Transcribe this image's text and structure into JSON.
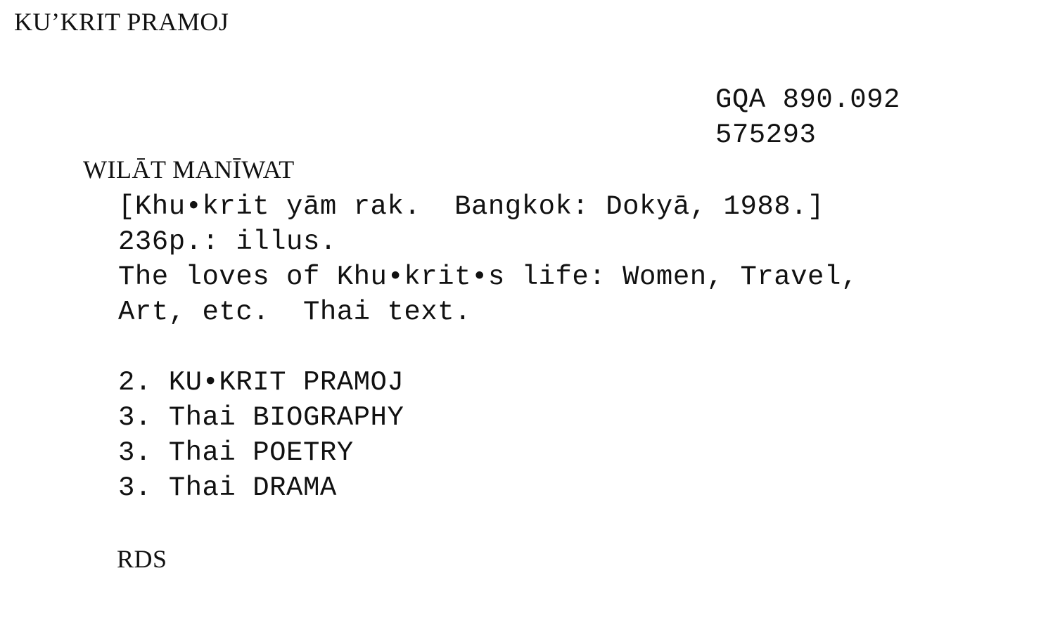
{
  "card": {
    "heading": "KU’KRIT PRAMOJ",
    "call_number": "GQA 890.092",
    "accession_number": "575293",
    "main_entry": "WILĀT MANĪWAT",
    "imprint": "[Khu•krit yām rak.  Bangkok: Dokyā, 1988.]",
    "collation": "236p.: illus.",
    "note_line_1": "The loves of Khu•krit•s life: Women, Travel,",
    "note_line_2": "Art, etc.  Thai text.",
    "added_entries": [
      "2. KU•KRIT PRAMOJ",
      "3. Thai BIOGRAPHY",
      "3. Thai POETRY",
      "3. Thai DRAMA"
    ],
    "cataloguer_initials": "RDS"
  }
}
